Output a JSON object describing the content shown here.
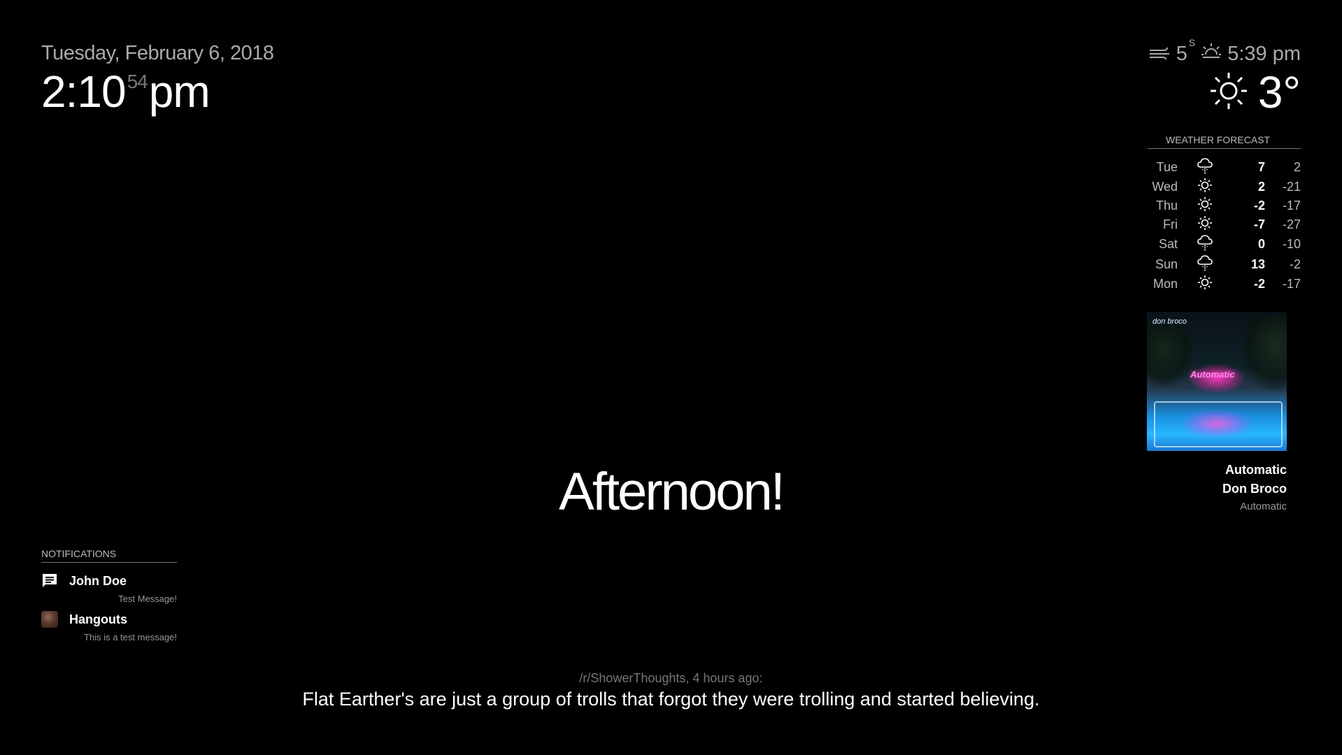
{
  "clock": {
    "date": "Tuesday, February 6, 2018",
    "hours_minutes": "2:10",
    "seconds": "54",
    "period": "pm"
  },
  "current_weather": {
    "wind_icon": "wind-icon",
    "wind_speed": "5",
    "wind_unit": "S",
    "sunset_icon": "sunset-icon",
    "sunset_time": "5:39 pm",
    "condition_icon": "sun-icon",
    "temperature": "3°"
  },
  "forecast": {
    "header": "WEATHER FORECAST",
    "days": [
      {
        "day": "Tue",
        "icon": "rain-icon",
        "max": "7",
        "min": "2"
      },
      {
        "day": "Wed",
        "icon": "sun-icon",
        "max": "2",
        "min": "-21"
      },
      {
        "day": "Thu",
        "icon": "sun-icon",
        "max": "-2",
        "min": "-17"
      },
      {
        "day": "Fri",
        "icon": "sun-icon",
        "max": "-7",
        "min": "-27"
      },
      {
        "day": "Sat",
        "icon": "rain-icon",
        "max": "0",
        "min": "-10"
      },
      {
        "day": "Sun",
        "icon": "rain-icon",
        "max": "13",
        "min": "-2"
      },
      {
        "day": "Mon",
        "icon": "sun-icon",
        "max": "-2",
        "min": "-17"
      }
    ]
  },
  "music": {
    "cover_brand": "don broco",
    "cover_neon": "Automatic",
    "title": "Automatic",
    "artist": "Don Broco",
    "album": "Automatic"
  },
  "greeting": "Afternoon!",
  "notifications": {
    "header": "NOTIFICATIONS",
    "items": [
      {
        "icon": "message-icon",
        "title": "John Doe",
        "body": "Test Message!"
      },
      {
        "icon": "hangouts-avatar",
        "title": "Hangouts",
        "body": "This is a test message!"
      }
    ]
  },
  "reddit": {
    "source": "/r/ShowerThoughts, 4 hours ago:",
    "post": "Flat Earther's are just a group of trolls that forgot they were trolling and started believing."
  },
  "colors": {
    "background": "#000000",
    "primary_text": "#ffffff",
    "dim_text": "#aaaaaa",
    "muted_text": "#777777"
  }
}
